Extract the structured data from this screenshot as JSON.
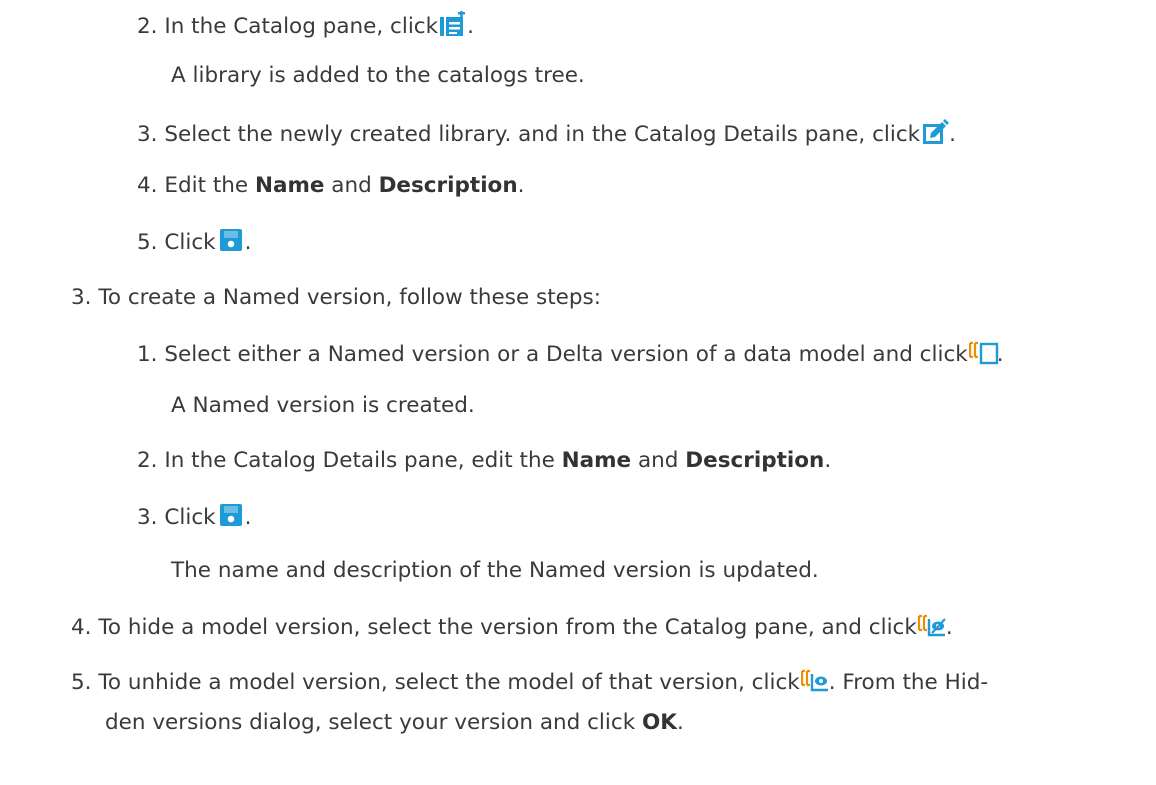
{
  "colors": {
    "text": "#3a3a3a",
    "icon_blue": "#1e9ad6",
    "icon_orange": "#f08c00"
  },
  "lines": {
    "l1": {
      "num": "2.",
      "pre": "In the Catalog pane, click",
      "icon": "add-library-icon",
      "post": "."
    },
    "l2": {
      "text": "A library is added to the catalogs tree."
    },
    "l3": {
      "num": "3.",
      "pre": "Select the newly created library. and in the Catalog Details pane, click",
      "icon": "edit-icon",
      "post": "."
    },
    "l4": {
      "num": "4.",
      "pre": "Edit the ",
      "b1": "Name",
      "mid": " and ",
      "b2": "Description",
      "post": "."
    },
    "l5": {
      "num": "5.",
      "pre": "Click",
      "icon": "save-icon",
      "post": "."
    },
    "l6": {
      "num": "3.",
      "text": "To create a Named version, follow these steps:"
    },
    "l7": {
      "num": "1.",
      "pre": "Select either a Named version or a Delta version of a data model and click",
      "icon": "named-version-icon",
      "post": "."
    },
    "l8": {
      "text": "A Named version is created."
    },
    "l9": {
      "num": "2.",
      "pre": "In the Catalog Details pane, edit the ",
      "b1": "Name",
      "mid": " and ",
      "b2": "Description",
      "post": "."
    },
    "l10": {
      "num": "3.",
      "pre": "Click",
      "icon": "save-icon",
      "post": "."
    },
    "l11": {
      "text": "The name and description of the Named version is updated."
    },
    "l12": {
      "num": "4.",
      "pre": "To hide a model version, select the version from the Catalog pane, and click",
      "icon": "hide-version-icon",
      "post": "."
    },
    "l13": {
      "num": "5.",
      "pre": "To unhide a model version, select the model of that version, click",
      "icon": "unhide-version-icon",
      "post": ". From the Hid-"
    },
    "l14": {
      "pre": "den versions dialog, select your version and click ",
      "b1": "OK",
      "post": "."
    }
  }
}
